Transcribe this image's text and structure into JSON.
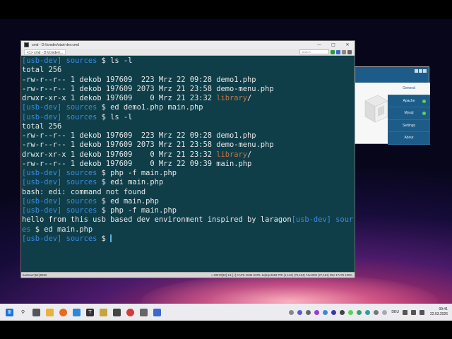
{
  "window": {
    "title": "cmd - D:\\/cmder/start-dev.cmd",
    "tab_label": "<1> cmd - D:\\/cmder\\...",
    "search_placeholder": "Search"
  },
  "terminal": {
    "lines": [
      [
        {
          "t": "[usb-dev]",
          "c": "p-user"
        },
        {
          "t": " sources",
          "c": "p-dir"
        },
        {
          "t": " $ ls -l",
          "c": ""
        }
      ],
      [
        {
          "t": "total 256",
          "c": ""
        }
      ],
      [
        {
          "t": "-rw-r--r-- 1 dekob 197609  223 Mrz 22 09:28 demo1.php",
          "c": ""
        }
      ],
      [
        {
          "t": "-rw-r--r-- 1 dekob 197609 2073 Mrz 21 23:58 demo-menu.php",
          "c": ""
        }
      ],
      [
        {
          "t": "drwxr-xr-x 1 dekob 197609    0 Mrz 21 23:32 ",
          "c": ""
        },
        {
          "t": "library",
          "c": "dirname"
        },
        {
          "t": "/",
          "c": ""
        }
      ],
      [
        {
          "t": "[usb-dev]",
          "c": "p-user"
        },
        {
          "t": " sources",
          "c": "p-dir"
        },
        {
          "t": " $ ed demo1.php main.php",
          "c": ""
        }
      ],
      [
        {
          "t": "[usb-dev]",
          "c": "p-user"
        },
        {
          "t": " sources",
          "c": "p-dir"
        },
        {
          "t": " $ ls -l",
          "c": ""
        }
      ],
      [
        {
          "t": "total 256",
          "c": ""
        }
      ],
      [
        {
          "t": "-rw-r--r-- 1 dekob 197609  223 Mrz 22 09:28 demo1.php",
          "c": ""
        }
      ],
      [
        {
          "t": "-rw-r--r-- 1 dekob 197609 2073 Mrz 21 23:58 demo-menu.php",
          "c": ""
        }
      ],
      [
        {
          "t": "drwxr-xr-x 1 dekob 197609    0 Mrz 21 23:32 ",
          "c": ""
        },
        {
          "t": "library",
          "c": "dirname"
        },
        {
          "t": "/",
          "c": ""
        }
      ],
      [
        {
          "t": "-rw-r--r-- 1 dekob 197609    0 Mrz 22 09:39 main.php",
          "c": ""
        }
      ],
      [
        {
          "t": "[usb-dev]",
          "c": "p-user"
        },
        {
          "t": " sources",
          "c": "p-dir"
        },
        {
          "t": " $ php -f main.php",
          "c": ""
        }
      ],
      [
        {
          "t": "[usb-dev]",
          "c": "p-user"
        },
        {
          "t": " sources",
          "c": "p-dir"
        },
        {
          "t": " $ edi main.php",
          "c": ""
        }
      ],
      [
        {
          "t": "bash: edi: command not found",
          "c": ""
        }
      ],
      [
        {
          "t": "[usb-dev]",
          "c": "p-user"
        },
        {
          "t": " sources",
          "c": "p-dir"
        },
        {
          "t": " $ ed main.php",
          "c": ""
        }
      ],
      [
        {
          "t": "[usb-dev]",
          "c": "p-user"
        },
        {
          "t": " sources",
          "c": "p-dir"
        },
        {
          "t": " $ php -f main.php",
          "c": ""
        }
      ],
      [
        {
          "t": "hello from this usb based dev environment inspired by laragon",
          "c": ""
        },
        {
          "t": "[usb-dev]",
          "c": "p-user"
        },
        {
          "t": " sourc",
          "c": "p-dir"
        }
      ],
      [
        {
          "t": "es",
          "c": "p-dir"
        },
        {
          "t": " $ ed main.php",
          "c": ""
        }
      ],
      [
        {
          "t": "[usb-dev]",
          "c": "p-user"
        },
        {
          "t": " sources",
          "c": "p-dir"
        },
        {
          "t": " $ ",
          "c": ""
        },
        {
          "t": "",
          "c": "cursor"
        }
      ]
    ]
  },
  "statusbar": {
    "left": "bashrae*[64]:8692",
    "right": "« 23072[32]  1/1  [+] CAPS NUM SCRL Sqlzip 8682  PRI  (1,142) (76,164)  74x1000  (27,161) 25V  17476 100%"
  },
  "panel": {
    "menu": [
      {
        "label": "General",
        "active": true,
        "status": ""
      },
      {
        "label": "Apache",
        "active": false,
        "status": "running"
      },
      {
        "label": "Mysql",
        "active": false,
        "status": "running"
      },
      {
        "label": "Settings",
        "active": false,
        "status": ""
      },
      {
        "label": "About",
        "active": false,
        "status": ""
      }
    ]
  },
  "taskbar": {
    "language": "DEU",
    "time": "09:41",
    "date": "22.03.2026"
  },
  "colors": {
    "terminal_bg": "#0f3e49",
    "prompt": "#3a8be0",
    "directory": "#d0703a",
    "panel_blue": "#1d5c88",
    "status_green": "#5bd35b"
  }
}
